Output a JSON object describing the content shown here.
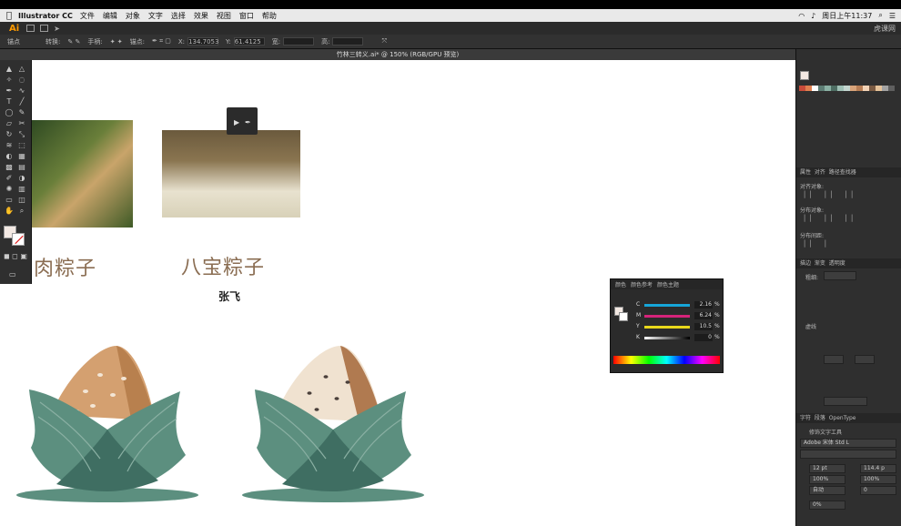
{
  "menubar": {
    "app_name": "Illustrator CC",
    "items": [
      "文件",
      "编辑",
      "对象",
      "文字",
      "选择",
      "效果",
      "视图",
      "窗口",
      "帮助"
    ],
    "clock": "周日上午11:37"
  },
  "appbar": {
    "logo": "Ai",
    "brand": "虎课网"
  },
  "control_bar": {
    "anchor_label": "锚点",
    "convert_label": "转换:",
    "handle_label": "手柄:",
    "anchor2_label": "锚点:",
    "x_label": "X:",
    "x_value": "134.7053",
    "y_label": "Y:",
    "y_value": "61.4125",
    "w_label": "宽:",
    "h_label": "高:"
  },
  "document": {
    "tab_title": "竹林三转义.ai* @ 150% (RGB/GPU 预览)"
  },
  "canvas": {
    "title1": "肉粽子",
    "title2": "八宝粽子",
    "author": "张飞"
  },
  "color_panel": {
    "tabs": [
      "颜色",
      "颜色参考",
      "颜色主题"
    ],
    "channels": [
      {
        "label": "C",
        "value": "2.16",
        "unit": "%",
        "color": "#16a5d8"
      },
      {
        "label": "M",
        "value": "6.24",
        "unit": "%",
        "color": "#d6237a"
      },
      {
        "label": "Y",
        "value": "10.5",
        "unit": "%",
        "color": "#e8d81b"
      },
      {
        "label": "K",
        "value": "0",
        "unit": "%",
        "color": "#bdbdbd"
      }
    ]
  },
  "right_panel": {
    "tabs1": [
      "属性",
      "对齐",
      "路径查找器"
    ],
    "align_objects": "对齐对象:",
    "distribute_objects": "分布对象:",
    "distribute_spacing": "分布间距:",
    "transform_tabs": [
      "描边",
      "渐变",
      "透明度"
    ],
    "weight_label": "粗细:",
    "dashed_label": "虚线",
    "char_tabs": [
      "字符",
      "段落",
      "OpenType"
    ],
    "touch_type": "修饰文字工具",
    "font_name": "Adobe 宋体 Std L",
    "font_size": "12 pt",
    "leading": "114.4 p",
    "scale_h": "100%",
    "scale_v": "100%",
    "kerning": "自动",
    "tracking": "0",
    "rotate": "0%"
  },
  "swatch_colors": [
    "#c94b3a",
    "#e07f4f",
    "#ffffff",
    "#5d7d74",
    "#8ab0a3",
    "#4e6e63",
    "#9fc0b5",
    "#c4d6cf",
    "#d9a47a",
    "#b87e55",
    "#f3d3b7",
    "#7a5a42",
    "#e6c39a",
    "#a3a3a3",
    "#5f5f5f"
  ],
  "colors": {
    "zongzi_leaf": "#5c8f7f",
    "zongzi_leaf_dark": "#3f6e62",
    "zongzi_rice1": "#d4a070",
    "zongzi_rice2": "#f0e2d0",
    "zongzi_shadow": "#5c8f7f"
  }
}
